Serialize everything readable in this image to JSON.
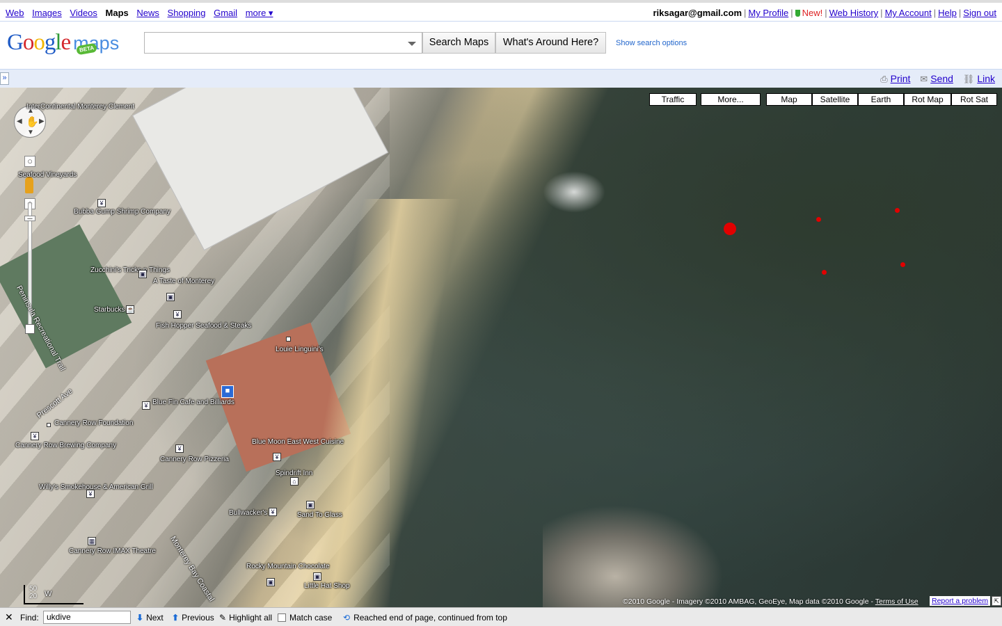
{
  "topnav": {
    "links": [
      "Web",
      "Images",
      "Videos",
      "Maps",
      "News",
      "Shopping",
      "Gmail",
      "more ▾"
    ],
    "active": "Maps",
    "user_email": "riksagar@gmail.com",
    "my_profile": "My Profile",
    "new_label": "New!",
    "web_history": "Web History",
    "my_account": "My Account",
    "help": "Help",
    "sign_out": "Sign out"
  },
  "header": {
    "logo_text": "Google",
    "logo_maps": "maps",
    "beta": "BETA",
    "search_value": "",
    "search_button": "Search Maps",
    "whats_around_button": "What's Around Here?",
    "show_options": "Show search options"
  },
  "bar": {
    "collapse": "»",
    "print": "Print",
    "send": "Send",
    "link": "Link"
  },
  "map_types": [
    "Traffic",
    "More...",
    "Map",
    "Satellite",
    "Earth",
    "Rot Map",
    "Rot Sat"
  ],
  "pois": [
    "InterContinental Monterey Clement",
    "Bubba Gump Shrimp Company",
    "Zucchini's Tricks n Things",
    "A Taste of Monterey",
    "Starbucks",
    "Fish Hopper Seafood & Steaks",
    "Louie Linguini's",
    "Blue Fin Cafe and Billiards",
    "Cannery Row Foundation",
    "Cannery Row Brewing Company",
    "Blue Moon East West Cuisine",
    "Cannery Row Pizzeria",
    "Spindrift Inn",
    "Willy's Smokehouse & American Grill",
    "Bullwacker's",
    "Sand To Glass",
    "Cannery Row IMAX Theatre",
    "Rocky Mountain Chocolate",
    "Little Hat Shop",
    "Seafood Vineyards"
  ],
  "roads": [
    "Peninsula Recreational Trail",
    "Prescott Ave",
    "Monterey Bay Coastal",
    "W"
  ],
  "scale": {
    "top": "50",
    "bottom": "20"
  },
  "copyright": "©2010 Google - Imagery ©2010 AMBAG, GeoEye, Map data ©2010 Google -",
  "terms": "Terms of Use",
  "report": "Report a problem",
  "findbar": {
    "label": "Find:",
    "value": "ukdive",
    "next": "Next",
    "previous": "Previous",
    "highlight": "Highlight all",
    "match_case": "Match case",
    "status": "Reached end of page, continued from top"
  },
  "colors": {
    "link": "#2200cc",
    "bar_bg": "#e5ecf9",
    "marker": "#e10000"
  }
}
